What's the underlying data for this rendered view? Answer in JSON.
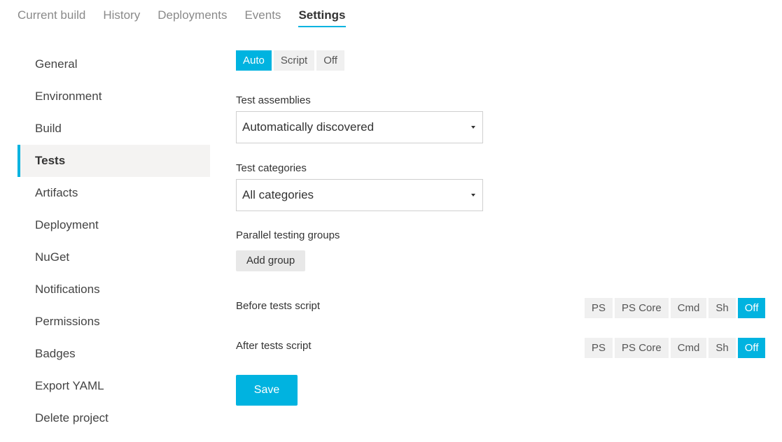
{
  "tabs": [
    "Current build",
    "History",
    "Deployments",
    "Events",
    "Settings"
  ],
  "active_tab": "Settings",
  "sidebar": {
    "items": [
      "General",
      "Environment",
      "Build",
      "Tests",
      "Artifacts",
      "Deployment",
      "NuGet",
      "Notifications",
      "Permissions",
      "Badges",
      "Export YAML",
      "Delete project"
    ],
    "active": "Tests"
  },
  "mode": {
    "options": [
      "Auto",
      "Script",
      "Off"
    ],
    "selected": "Auto"
  },
  "test_assemblies": {
    "label": "Test assemblies",
    "value": "Automatically discovered"
  },
  "test_categories": {
    "label": "Test categories",
    "value": "All categories"
  },
  "parallel": {
    "label": "Parallel testing groups",
    "button": "Add group"
  },
  "before_script": {
    "label": "Before tests script",
    "options": [
      "PS",
      "PS Core",
      "Cmd",
      "Sh",
      "Off"
    ],
    "selected": "Off"
  },
  "after_script": {
    "label": "After tests script",
    "options": [
      "PS",
      "PS Core",
      "Cmd",
      "Sh",
      "Off"
    ],
    "selected": "Off"
  },
  "save_label": "Save",
  "colors": {
    "accent": "#00b3e0",
    "active_bg": "#f4f3f2",
    "button_bg": "#f0f0f0"
  }
}
